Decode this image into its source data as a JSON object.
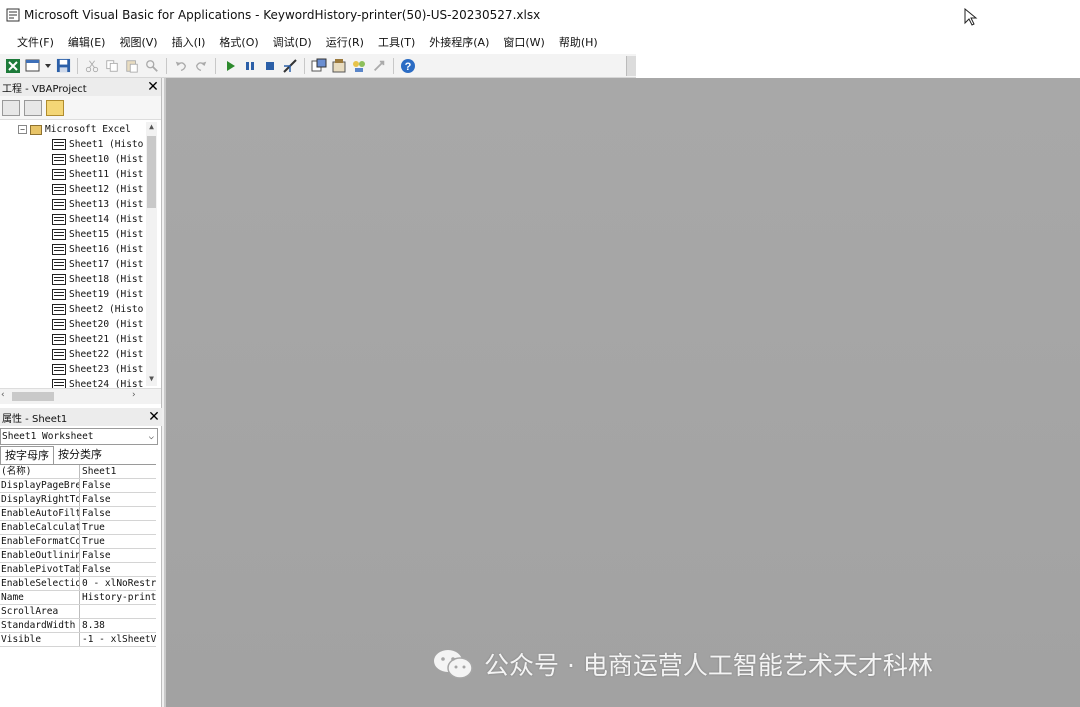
{
  "window": {
    "title": "Microsoft Visual Basic for Applications - KeywordHistory-printer(50)-US-20230527.xlsx"
  },
  "menu": [
    "文件(F)",
    "编辑(E)",
    "视图(V)",
    "插入(I)",
    "格式(O)",
    "调试(D)",
    "运行(R)",
    "工具(T)",
    "外接程序(A)",
    "窗口(W)",
    "帮助(H)"
  ],
  "project_panel": {
    "title": "工程 - VBAProject",
    "root": "Microsoft Excel",
    "sheets": [
      "Sheet1 (Histo",
      "Sheet10 (Hist",
      "Sheet11 (Hist",
      "Sheet12 (Hist",
      "Sheet13 (Hist",
      "Sheet14 (Hist",
      "Sheet15 (Hist",
      "Sheet16 (Hist",
      "Sheet17 (Hist",
      "Sheet18 (Hist",
      "Sheet19 (Hist",
      "Sheet2 (Histo",
      "Sheet20 (Hist",
      "Sheet21 (Hist",
      "Sheet22 (Hist",
      "Sheet23 (Hist",
      "Sheet24 (Hist"
    ]
  },
  "properties_panel": {
    "title": "属性 - Sheet1",
    "object_select": "Sheet1 Worksheet",
    "tabs": [
      "按字母序",
      "按分类序"
    ],
    "rows": [
      {
        "name": "(名称)",
        "value": "Sheet1"
      },
      {
        "name": "DisplayPageBre",
        "value": "False"
      },
      {
        "name": "DisplayRightTo",
        "value": "False"
      },
      {
        "name": "EnableAutoFilt",
        "value": "False"
      },
      {
        "name": "EnableCalculat",
        "value": "True"
      },
      {
        "name": "EnableFormatCo",
        "value": "True"
      },
      {
        "name": "EnableOutlinin",
        "value": "False"
      },
      {
        "name": "EnablePivotTab",
        "value": "False"
      },
      {
        "name": "EnableSelectio",
        "value": "0 - xlNoRestr"
      },
      {
        "name": "Name",
        "value": "History-print"
      },
      {
        "name": "ScrollArea",
        "value": ""
      },
      {
        "name": "StandardWidth",
        "value": "8.38"
      },
      {
        "name": "Visible",
        "value": "-1 - xlSheetV"
      }
    ]
  },
  "watermark": {
    "text": "公众号 · 电商运营人工智能艺术天才科林"
  },
  "colors": {
    "workspace": "#a6a6a6",
    "panel_bg": "#ffffff",
    "help_icon": "#2b6cc4"
  },
  "icons": [
    "excel-icon",
    "insert-form-icon",
    "save-icon",
    "cut-icon",
    "copy-icon",
    "paste-icon",
    "find-icon",
    "undo-icon",
    "redo-icon",
    "run-icon",
    "break-icon",
    "reset-icon",
    "design-mode-icon",
    "project-explorer-icon",
    "properties-icon",
    "object-browser-icon",
    "toolbox-icon",
    "help-icon"
  ]
}
